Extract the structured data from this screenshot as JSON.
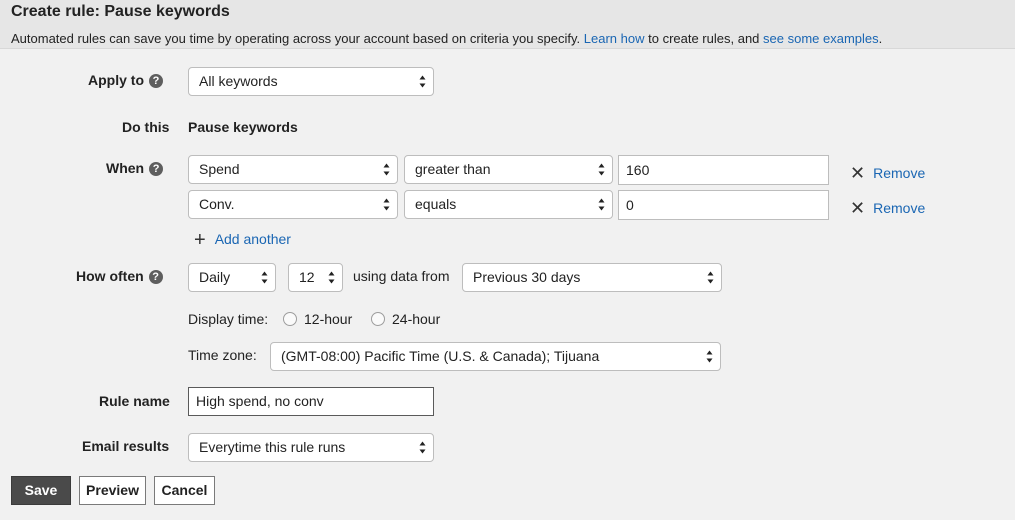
{
  "header": {
    "title": "Create rule: Pause keywords",
    "intro_before": "Automated rules can save you time by operating across your account based on criteria you specify. ",
    "learn_how": "Learn how",
    "intro_middle": " to create rules, and ",
    "see_examples": "see some examples",
    "intro_end": "."
  },
  "apply_to": {
    "label": "Apply to",
    "value": "All keywords"
  },
  "do_this": {
    "label": "Do this",
    "value": "Pause keywords"
  },
  "when": {
    "label": "When",
    "conditions": [
      {
        "metric": "Spend",
        "operator": "greater than",
        "value": "160",
        "remove": "Remove"
      },
      {
        "metric": "Conv.",
        "operator": "equals",
        "value": "0",
        "remove": "Remove"
      }
    ],
    "add_another": "Add another"
  },
  "how_often": {
    "label": "How often",
    "frequency": "Daily",
    "hour": "12",
    "using_data_from": "using data from",
    "date_range": "Previous 30 days",
    "display_time_label": "Display time:",
    "option_12": "12-hour",
    "option_24": "24-hour",
    "timezone_label": "Time zone:",
    "timezone": "(GMT-08:00) Pacific Time (U.S. & Canada); Tijuana"
  },
  "rule_name": {
    "label": "Rule name",
    "value": "High spend, no conv"
  },
  "email_results": {
    "label": "Email results",
    "value": "Everytime this rule runs"
  },
  "buttons": {
    "save": "Save",
    "preview": "Preview",
    "cancel": "Cancel"
  },
  "colors": {
    "link": "#1a66b3",
    "header_bg": "#e6e6e6",
    "page_bg": "#f1f1f1",
    "save_bg": "#4a4a4a"
  },
  "help_icon": "?"
}
